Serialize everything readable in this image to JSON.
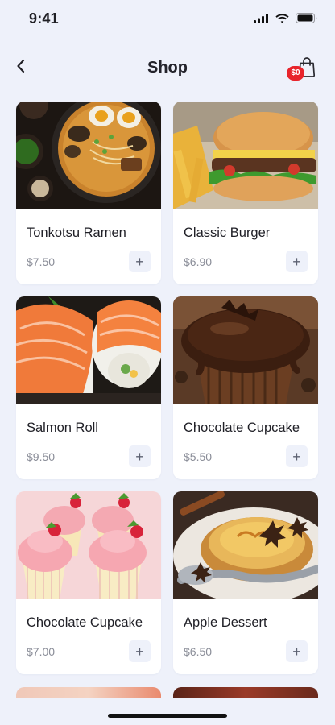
{
  "status": {
    "time": "9:41"
  },
  "header": {
    "title": "Shop",
    "cart_badge": "$0"
  },
  "products": [
    {
      "name": "Tonkotsu Ramen",
      "price": "$7.50",
      "add_label": "+"
    },
    {
      "name": "Classic Burger",
      "price": "$6.90",
      "add_label": "+"
    },
    {
      "name": "Salmon Roll",
      "price": "$9.50",
      "add_label": "+"
    },
    {
      "name": "Chocolate Cupcake",
      "price": "$5.50",
      "add_label": "+"
    },
    {
      "name": "Chocolate Cupcake",
      "price": "$7.00",
      "add_label": "+"
    },
    {
      "name": "Apple Dessert",
      "price": "$6.50",
      "add_label": "+"
    }
  ],
  "colors": {
    "background": "#EEF1FA",
    "badge": "#E8242B",
    "card": "#FFFFFF",
    "price": "#8A8D98"
  },
  "icons": {
    "back": "chevron-left-icon",
    "cart": "shopping-bag-icon",
    "add": "plus-icon"
  }
}
